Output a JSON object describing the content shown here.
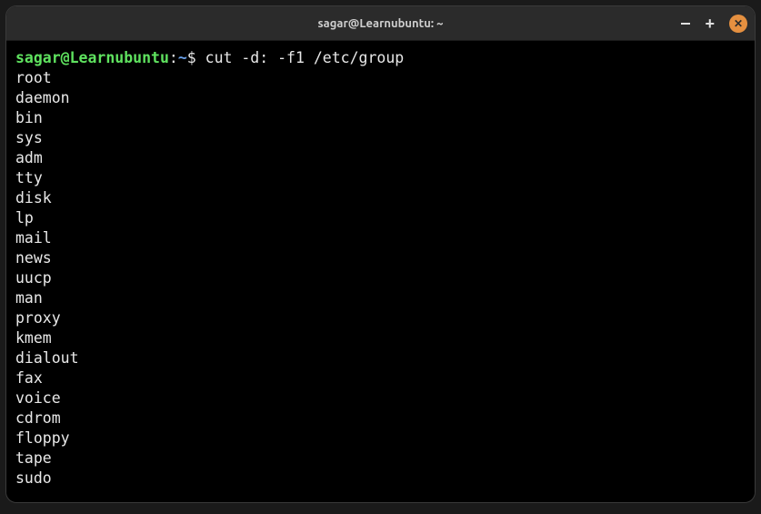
{
  "window": {
    "title": "sagar@Learnubuntu: ~"
  },
  "prompt": {
    "user_host": "sagar@Learnubuntu",
    "colon": ":",
    "path": "~",
    "dollar": "$ "
  },
  "command": "cut -d: -f1 /etc/group",
  "output": [
    "root",
    "daemon",
    "bin",
    "sys",
    "adm",
    "tty",
    "disk",
    "lp",
    "mail",
    "news",
    "uucp",
    "man",
    "proxy",
    "kmem",
    "dialout",
    "fax",
    "voice",
    "cdrom",
    "floppy",
    "tape",
    "sudo"
  ]
}
